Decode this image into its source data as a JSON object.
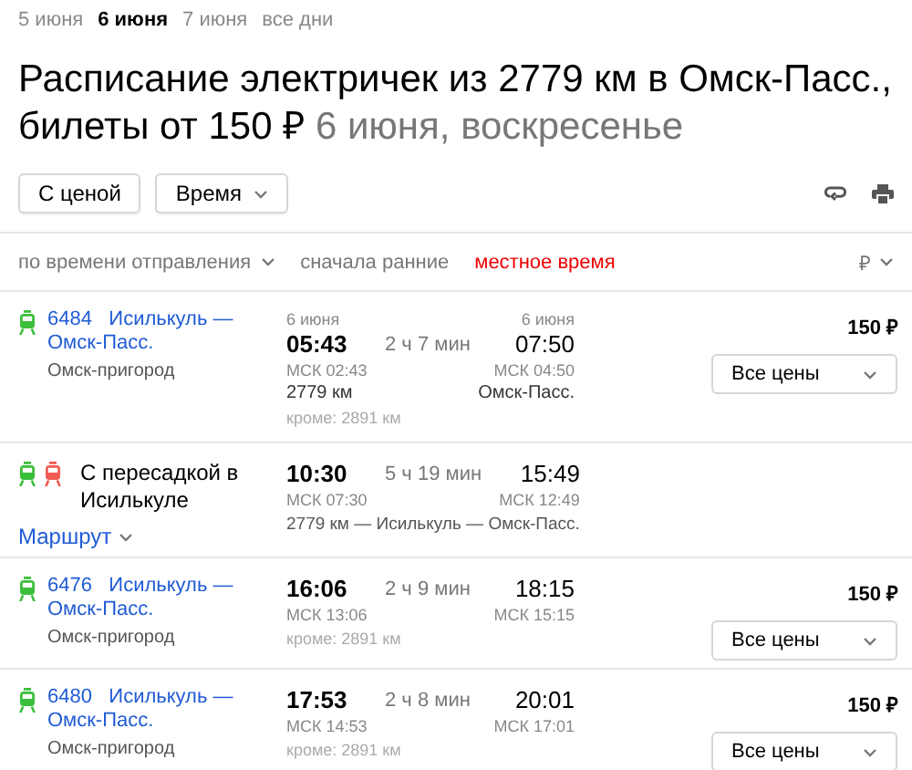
{
  "dates": [
    {
      "label": "5 июня",
      "selected": false
    },
    {
      "label": "6 июня",
      "selected": true
    },
    {
      "label": "7 июня",
      "selected": false
    },
    {
      "label": "все дни",
      "selected": false
    }
  ],
  "title": {
    "main": "Расписание электричек из 2779 км в Омск-Пасс., билеты от 150 ₽",
    "date": "6 июня, воскресенье"
  },
  "filters": [
    {
      "label": "С ценой",
      "kind": "button"
    },
    {
      "label": "Время",
      "kind": "dropdown"
    }
  ],
  "sort": {
    "order": "по времени отправления",
    "direction": "сначала ранние",
    "timezone": "местное время",
    "currency": "₽"
  },
  "trips": [
    {
      "kind": "train",
      "icons": [
        {
          "color": "#3bbf3b"
        }
      ],
      "number": "6484",
      "route": "Исилькуль — Омск-Пасс.",
      "carrier": "Омск-пригород",
      "departure": {
        "date": "6 июня",
        "time": "05:43",
        "msk": "МСК 02:43",
        "station": "2779 км"
      },
      "except": "кроме: 2891 км",
      "duration": "2 ч 7 мин",
      "arrival": {
        "date": "6 июня",
        "time": "07:50",
        "msk": "МСК 04:50",
        "station": "Омск-Пасс."
      },
      "price": "150 ₽",
      "price_select": "Все цены"
    },
    {
      "kind": "transfer",
      "icons": [
        {
          "color": "#3bbf3b"
        },
        {
          "color": "#f25a55"
        }
      ],
      "title": "С пересадкой в Исилькуле",
      "link": "Маршрут",
      "departure": {
        "time": "10:30",
        "msk": "МСК 07:30"
      },
      "duration": "5 ч 19 мин",
      "arrival": {
        "time": "15:49",
        "msk": "МСК 12:49"
      },
      "path": "2779 км — Исилькуль — Омск-Пасс."
    },
    {
      "kind": "train",
      "icons": [
        {
          "color": "#3bbf3b"
        }
      ],
      "number": "6476",
      "route": "Исилькуль — Омск-Пасс.",
      "carrier": "Омск-пригород",
      "departure": {
        "time": "16:06",
        "msk": "МСК 13:06"
      },
      "except": "кроме: 2891 км",
      "duration": "2 ч 9 мин",
      "arrival": {
        "time": "18:15",
        "msk": "МСК 15:15"
      },
      "price": "150 ₽",
      "price_select": "Все цены"
    },
    {
      "kind": "train",
      "icons": [
        {
          "color": "#3bbf3b"
        }
      ],
      "number": "6480",
      "route": "Исилькуль — Омск-Пасс.",
      "carrier": "Омск-пригород",
      "departure": {
        "time": "17:53",
        "msk": "МСК 14:53"
      },
      "except": "кроме: 2891 км",
      "duration": "2 ч 8 мин",
      "arrival": {
        "time": "20:01",
        "msk": "МСК 17:01"
      },
      "price": "150 ₽",
      "price_select": "Все цены"
    }
  ]
}
